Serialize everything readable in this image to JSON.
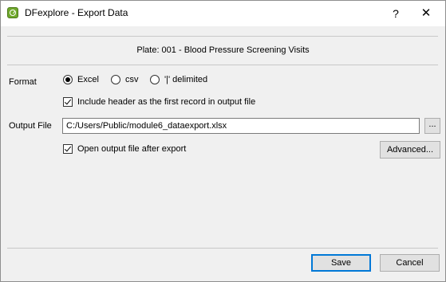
{
  "window": {
    "title": "DFexplore - Export Data",
    "help_glyph": "?",
    "close_glyph": "✕"
  },
  "plate_title": "Plate: 001 - Blood Pressure Screening Visits",
  "format": {
    "label": "Format",
    "options": [
      {
        "label": "Excel",
        "selected": true
      },
      {
        "label": "csv",
        "selected": false
      },
      {
        "label": "'|' delimited",
        "selected": false
      }
    ]
  },
  "include_header": {
    "label": "Include header as the first record in output file",
    "checked": true
  },
  "output_file": {
    "label": "Output File",
    "value": "C:/Users/Public/module6_dataexport.xlsx",
    "browse_label": "..."
  },
  "open_after": {
    "label": "Open output file after export",
    "checked": true
  },
  "advanced_label": "Advanced...",
  "buttons": {
    "save": "Save",
    "cancel": "Cancel"
  }
}
